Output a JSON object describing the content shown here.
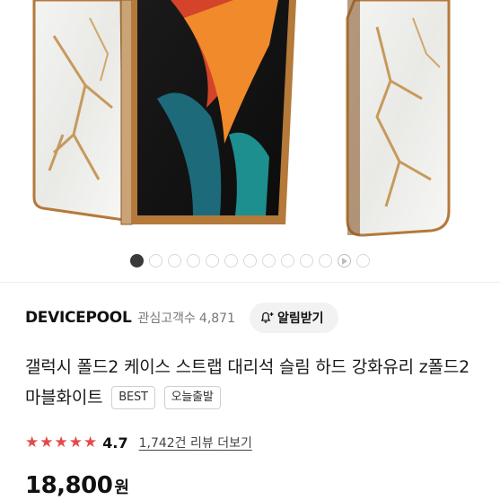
{
  "colors": {
    "accent_star": "#e44a4a",
    "gold_frame": "#b5793a",
    "dot_active": "#3a3a3a"
  },
  "carousel": {
    "total": 13,
    "active_index": 0,
    "video_index": 11
  },
  "store": {
    "name": "DEVICEPOOL",
    "followers_label": "관심고객수",
    "followers_count": "4,871",
    "alarm_button_label": "알림받기",
    "alarm_icon": "bell-plus-icon"
  },
  "product": {
    "title": "갤럭시 폴드2 케이스 스트랩 대리석 슬림 하드 강화유리 z폴드2 마블화이트",
    "badges": [
      "BEST",
      "오늘출발"
    ],
    "rating_score": "4.7",
    "rating_stars": 4.7,
    "review_link": "1,742건 리뷰 더보기",
    "price": "18,800",
    "currency": "원"
  }
}
